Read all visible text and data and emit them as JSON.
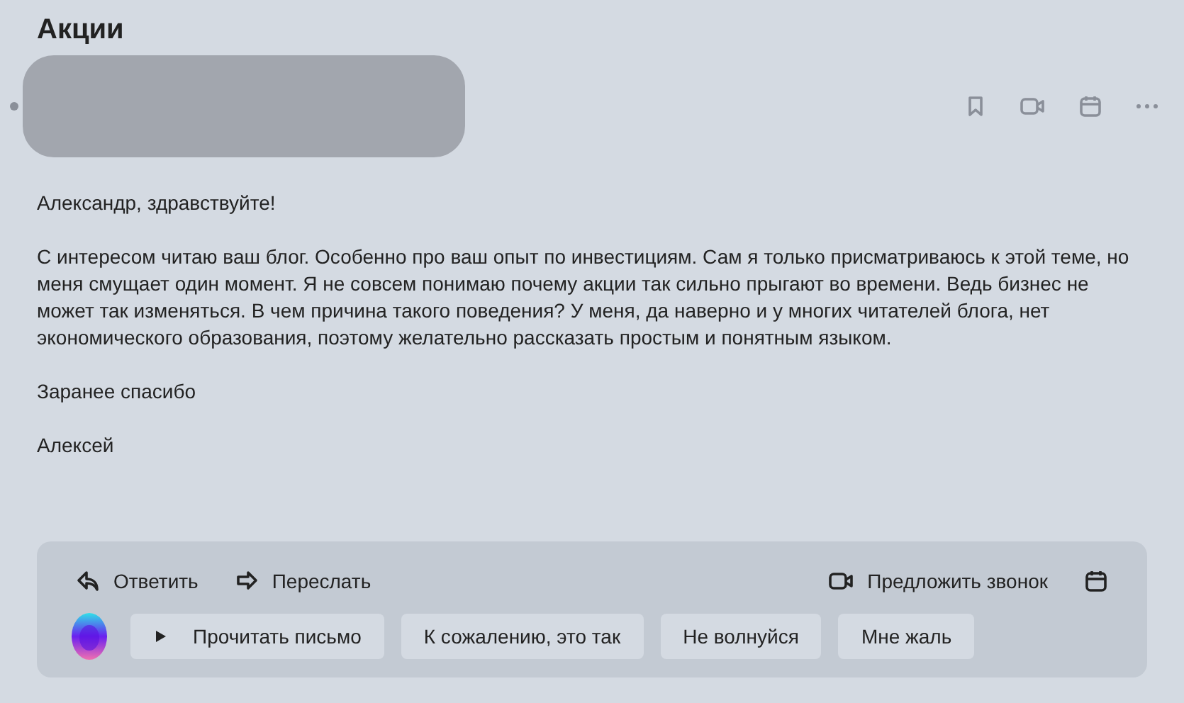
{
  "subject": "Акции",
  "message": {
    "paragraphs": [
      "Александр, здравствуйте!",
      "С интересом читаю ваш блог. Особенно про ваш опыт по инвестициям. Сам я только присматриваюсь к этой теме, но меня смущает один момент. Я не совсем понимаю почему акции так сильно прыгают во времени. Ведь бизнес не может так изменяться. В чем причина такого поведения? У меня, да наверно и у многих читателей блога, нет экономического образования, поэтому желательно рассказать простым и понятным языком.",
      "Заранее спасибо",
      "Алексей"
    ]
  },
  "actions": [
    {
      "label": "Ответить",
      "kind": "reply"
    },
    {
      "label": "Переслать",
      "kind": "forward"
    }
  ],
  "call_button": {
    "label": "Предложить звонок"
  },
  "quick_replies": [
    {
      "label": "Прочитать письмо",
      "kind": "play"
    },
    {
      "label": "К сожалению, это так",
      "kind": "text"
    },
    {
      "label": "Не волнуйся",
      "kind": "text"
    },
    {
      "label": "Мне жаль",
      "kind": "text"
    }
  ]
}
